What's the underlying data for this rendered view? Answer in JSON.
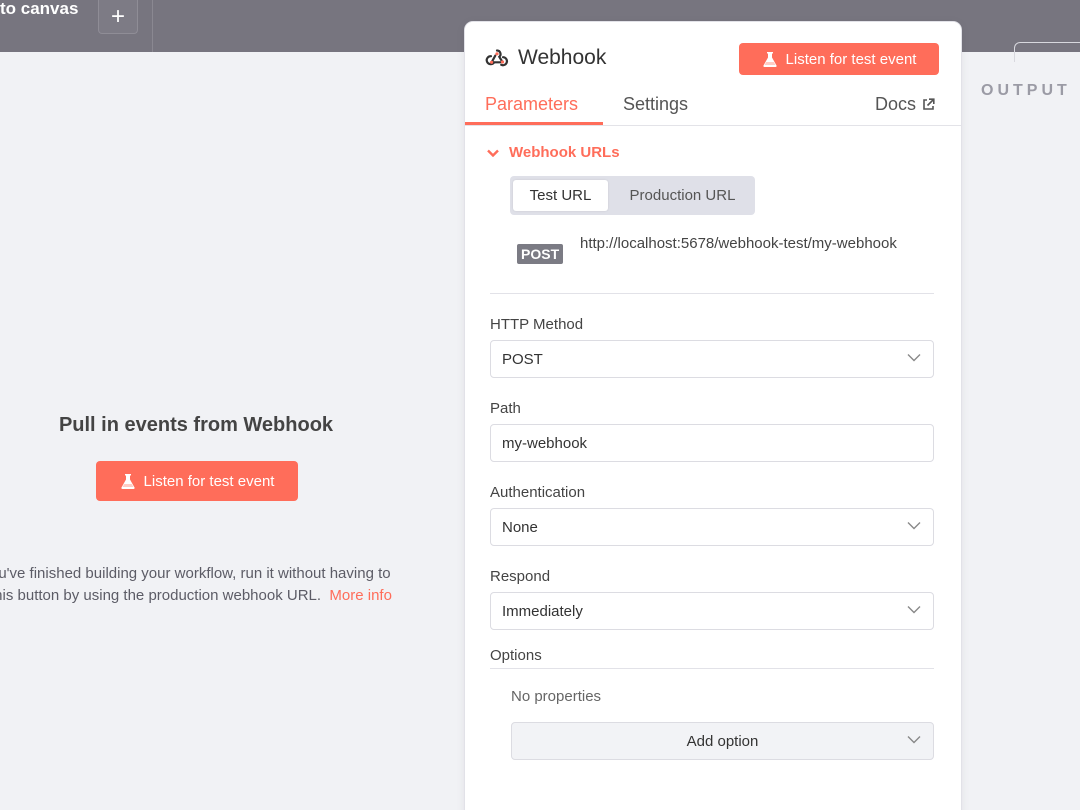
{
  "topbar": {
    "back_label": "to canvas",
    "add_glyph": "+"
  },
  "input_panel": {
    "title": "Pull in events from Webhook",
    "listen_label": "Listen for test event",
    "description_line1": "ou've finished building your workflow, run it without having to",
    "description_line2": "this button by using the production webhook URL.",
    "more_info": "More info"
  },
  "output": {
    "label": "OUTPUT"
  },
  "node": {
    "title": "Webhook",
    "icon": "webhook-icon",
    "listen_label": "Listen for test event",
    "tabs": {
      "parameters": "Parameters",
      "settings": "Settings",
      "docs": "Docs"
    }
  },
  "webhook_urls": {
    "section_label": "Webhook URLs",
    "toggle": {
      "test": "Test URL",
      "production": "Production URL",
      "selected": "Test URL"
    },
    "method": "POST",
    "url": "http://localhost:5678/webhook-test/my-webhook"
  },
  "params": {
    "http_method_label": "HTTP Method",
    "http_method_value": "POST",
    "path_label": "Path",
    "path_value": "my-webhook",
    "auth_label": "Authentication",
    "auth_value": "None",
    "respond_label": "Respond",
    "respond_value": "Immediately",
    "options_label": "Options",
    "no_properties": "No properties",
    "add_option": "Add option"
  },
  "colors": {
    "accent": "#ff6d5a",
    "topbar": "#77757f",
    "canvas": "#f1f2f5"
  }
}
